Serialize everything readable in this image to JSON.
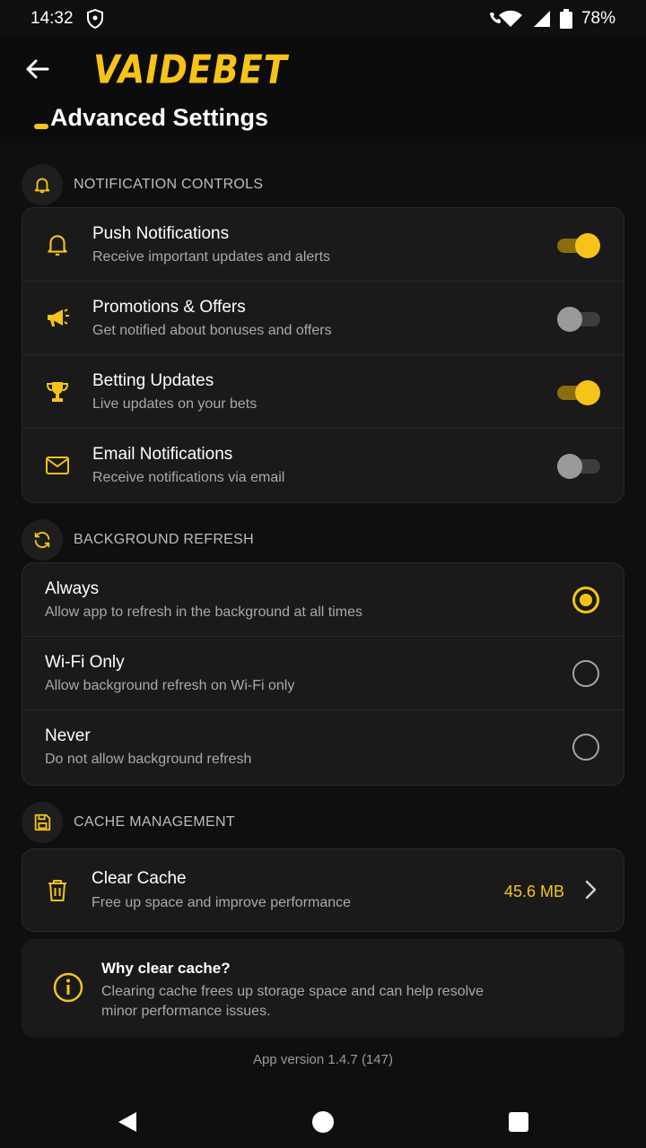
{
  "status_bar": {
    "time": "14:32",
    "battery": "78%"
  },
  "header": {
    "brand": "VAIDEBET",
    "title": "Advanced Settings"
  },
  "sections": {
    "notifications": {
      "label": "NOTIFICATION CONTROLS",
      "icon": "bell-icon"
    },
    "refresh": {
      "label": "BACKGROUND REFRESH",
      "icon": "refresh-icon"
    },
    "cache": {
      "label": "CACHE MANAGEMENT",
      "icon": "save-icon"
    }
  },
  "notifications": [
    {
      "title": "Push Notifications",
      "subtitle": "Receive important updates and alerts",
      "icon": "bell-icon",
      "enabled": true
    },
    {
      "title": "Promotions & Offers",
      "subtitle": "Get notified about bonuses and offers",
      "icon": "megaphone-icon",
      "enabled": false
    },
    {
      "title": "Betting Updates",
      "subtitle": "Live updates on your bets",
      "icon": "trophy-icon",
      "enabled": true
    },
    {
      "title": "Email Notifications",
      "subtitle": "Receive notifications via email",
      "icon": "mail-icon",
      "enabled": false
    }
  ],
  "refresh_options": [
    {
      "title": "Always",
      "subtitle": "Allow app to refresh in the background at all times",
      "selected": true
    },
    {
      "title": "Wi-Fi Only",
      "subtitle": "Allow background refresh on Wi-Fi only",
      "selected": false
    },
    {
      "title": "Never",
      "subtitle": "Do not allow background refresh",
      "selected": false
    }
  ],
  "cache": {
    "title": "Clear Cache",
    "subtitle": "Free up space and improve performance",
    "size": "45.6 MB",
    "icon": "trash-icon"
  },
  "info": {
    "title": "Why clear cache?",
    "text": "Clearing cache frees up storage space and can help resolve minor performance issues.",
    "icon": "info-icon"
  },
  "footer": {
    "version": "App version 1.4.7 (147)"
  },
  "colors": {
    "accent": "#f7c318",
    "background": "#0f0f0f",
    "card": "#1a1a1a"
  }
}
